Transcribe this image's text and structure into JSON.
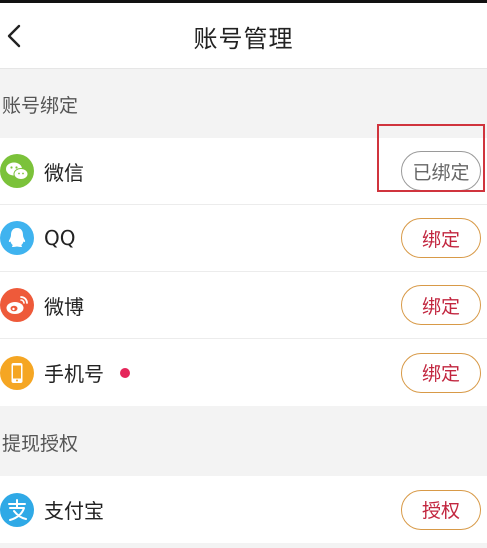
{
  "header": {
    "title": "账号管理",
    "back_icon": "chevron-left-icon"
  },
  "sections": {
    "binding": {
      "label": "账号绑定",
      "items": [
        {
          "label": "微信",
          "icon": "wechat-icon",
          "button": "已绑定",
          "state": "bound",
          "color": "#7bc23a"
        },
        {
          "label": "QQ",
          "icon": "qq-icon",
          "button": "绑定",
          "state": "unbound",
          "color": "#3fb3ef"
        },
        {
          "label": "微博",
          "icon": "weibo-icon",
          "button": "绑定",
          "state": "unbound",
          "color": "#ee5a3a"
        },
        {
          "label": "手机号",
          "icon": "phone-icon",
          "button": "绑定",
          "state": "unbound",
          "color": "#f5a623",
          "has_dot": true
        }
      ]
    },
    "withdraw": {
      "label": "提现授权",
      "items": [
        {
          "label": "支付宝",
          "icon": "alipay-icon",
          "button": "授权",
          "state": "unbound",
          "color": "#2fa9e6"
        }
      ]
    }
  },
  "colors": {
    "accent_text": "#c2263f",
    "accent_border": "#d89a48",
    "notification_dot": "#e5265a",
    "highlight_frame": "#d0343d"
  }
}
